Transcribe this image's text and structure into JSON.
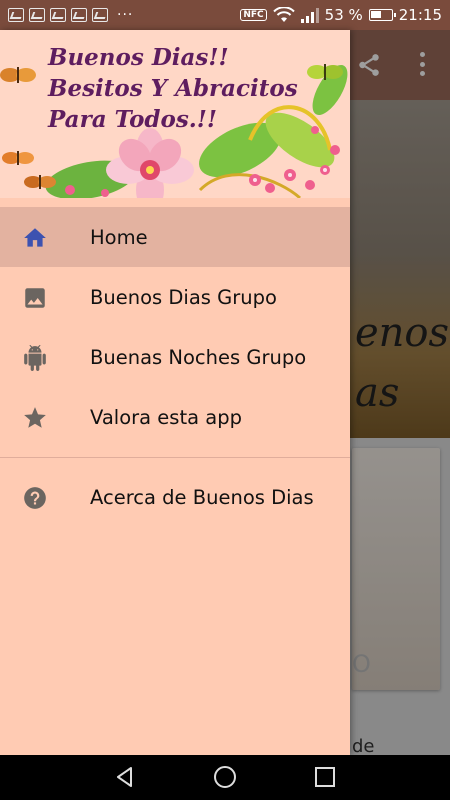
{
  "status_bar": {
    "more_indicator": "···",
    "nfc_label": "NFC",
    "battery_percent": "53 %",
    "time": "21:15",
    "icons": [
      "notification-icon",
      "wifi-icon",
      "signal-icon",
      "battery-icon"
    ]
  },
  "background_app": {
    "hero_text_line1": "enos",
    "hero_text_line2": "as",
    "card_fragment": "O",
    "bottom_fragment": "de",
    "toolbar_icons": [
      "share-icon",
      "overflow-menu-icon"
    ]
  },
  "drawer": {
    "header": {
      "line1": "Buenos Dias!!",
      "line2": "Besitos Y Abracitos",
      "line3": "Para Todos.!!"
    },
    "items": [
      {
        "label": "Home",
        "icon": "home-icon",
        "active": true
      },
      {
        "label": "Buenos Dias Grupo",
        "icon": "image-icon",
        "active": false
      },
      {
        "label": "Buenas Noches Grupo",
        "icon": "android-icon",
        "active": false
      },
      {
        "label": "Valora esta app",
        "icon": "star-icon",
        "active": false
      }
    ],
    "secondary_items": [
      {
        "label": "Acerca de Buenos Dias",
        "icon": "help-icon",
        "active": false
      }
    ]
  },
  "colors": {
    "drawer_bg": "#ffcbb3",
    "active_item_bg": "#e3b2a0",
    "home_icon": "#3d52b0",
    "other_icons": "#6b6560",
    "status_bar_bg": "#7a4b3c",
    "header_text": "#5e1d5f"
  },
  "system_nav": [
    "back-button",
    "home-button",
    "recents-button"
  ]
}
